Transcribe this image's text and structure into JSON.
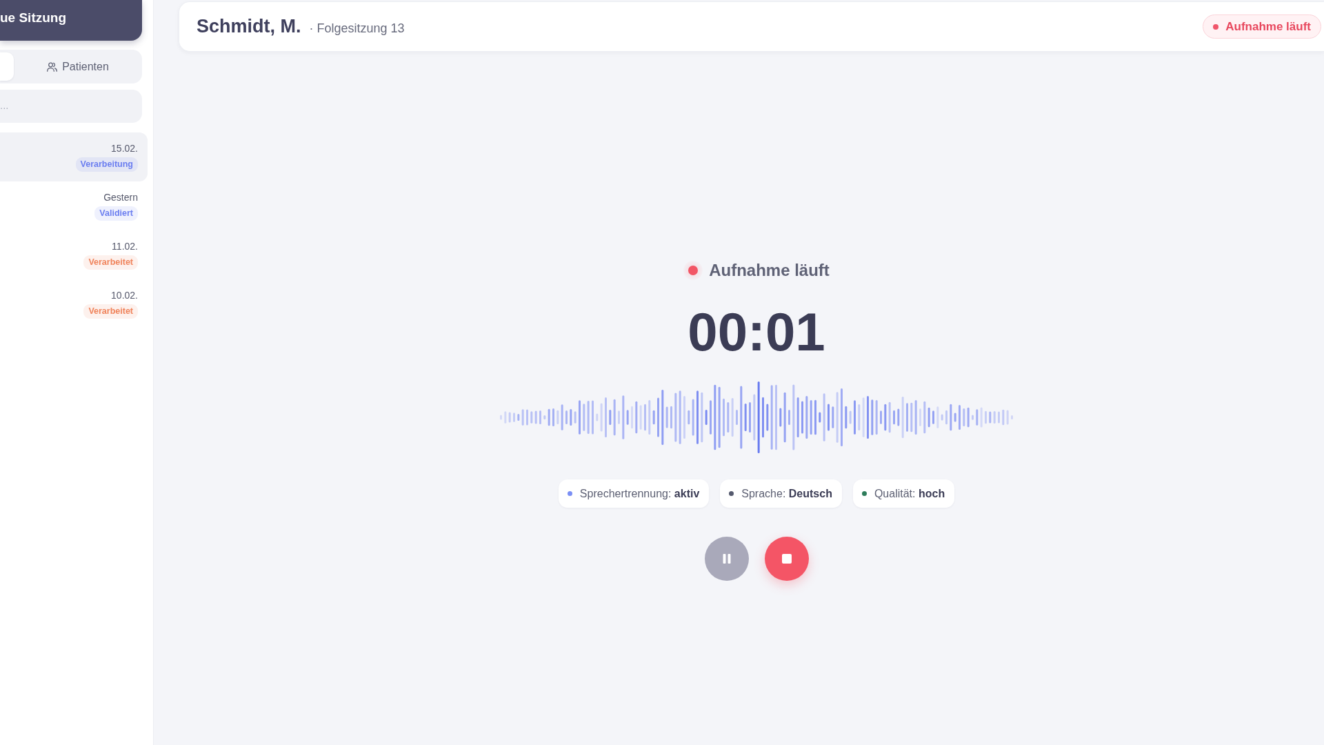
{
  "sidebar": {
    "new_session_button": "ue Sitzung",
    "tabs": [
      {
        "selected": true
      },
      {
        "label": "Patienten",
        "selected": false
      }
    ],
    "search": {
      "placeholder": "..."
    },
    "sessions": [
      {
        "date": "15.02.",
        "status": "Verarbeitung",
        "color": "#6b7ef0",
        "selected": true
      },
      {
        "date": "Gestern",
        "status": "Validiert",
        "color": "#6b7ef0",
        "selected": false
      },
      {
        "date": "11.02.",
        "status": "Verarbeitet",
        "color": "#f0845c",
        "selected": false
      },
      {
        "date": "10.02.",
        "status": "Verarbeitet",
        "color": "#f0845c",
        "selected": false
      }
    ]
  },
  "header": {
    "patient": "Schmidt, M.",
    "session": "· Folgesitzung 13",
    "status": "Aufnahme läuft"
  },
  "recorder": {
    "status": "Aufnahme läuft",
    "timer": "00:01",
    "chips": [
      {
        "text": "Sprechertrennung: **aktiv**",
        "color": "#7b8ff5"
      },
      {
        "text": "Sprache: **Deutsch**",
        "color": "#555a6e"
      },
      {
        "text": "Qualität: **hoch**",
        "color": "#2e7d5b"
      }
    ],
    "controls": [
      {
        "kind": "pause"
      },
      {
        "kind": "stop"
      }
    ]
  }
}
